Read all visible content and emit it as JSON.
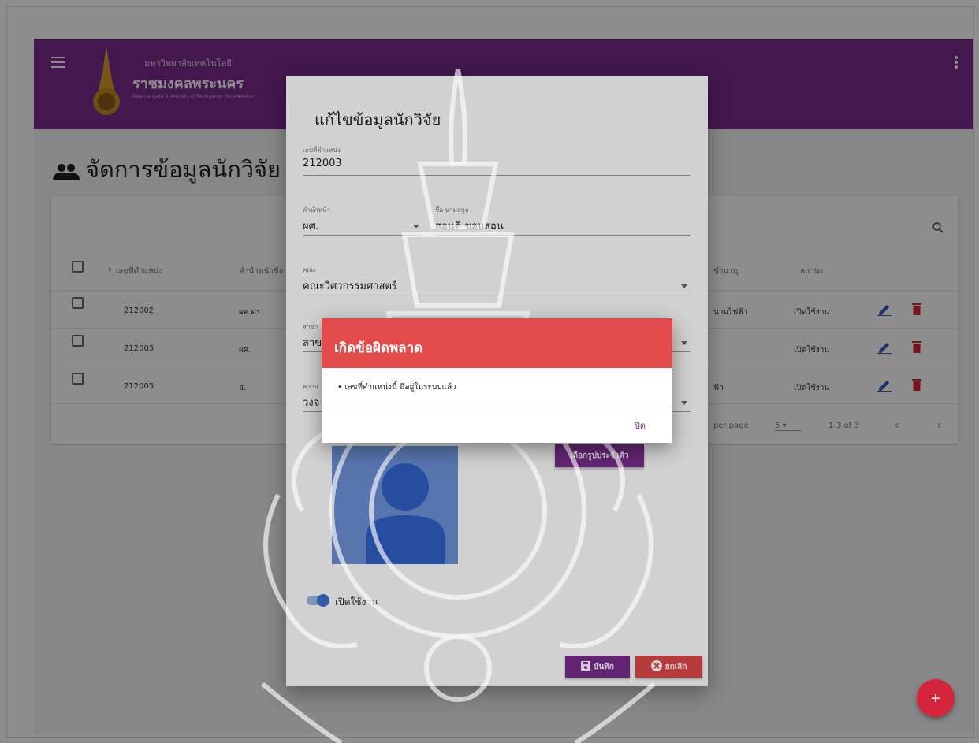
{
  "header": {
    "university_small": "มหาวิทยาลัยเทคโนโลยี",
    "university_big": "ราชมงคลพระนคร",
    "university_en": "Rajamangala University of Technology Phra Nakhon"
  },
  "page": {
    "title": "จัดการข้อมูลนักวิจัย"
  },
  "table": {
    "columns": {
      "position_no": "เลขที่ตำแหน่ง",
      "prefix_name": "คำนำหน้าชื่อ",
      "expertise": "ชำนาญ",
      "status": "สถานะ"
    },
    "rows": [
      {
        "position_no": "212002",
        "prefix": "ผศ.ดร.",
        "expertise": "นามไฟฟ้า",
        "status": "เปิดใช้งาน"
      },
      {
        "position_no": "212003",
        "prefix": "ผศ.",
        "expertise": "",
        "status": "เปิดใช้งาน"
      },
      {
        "position_no": "212003",
        "prefix": "อ.",
        "expertise": "ฟ้า",
        "status": "เปิดใช้งาน"
      }
    ],
    "footer": {
      "rows_per_page_label": "per page:",
      "rows_per_page": "5",
      "range": "1-3 of 3"
    }
  },
  "edit_dialog": {
    "title": "แก้ไขข้อมูลนักวิจัย",
    "position_no": {
      "label": "เลขที่ตำแหน่ง",
      "value": "212003"
    },
    "prefix": {
      "label": "คำนำหน้า",
      "value": "ผศ."
    },
    "fullname": {
      "label": "ชื่อ นามสกุล",
      "value": "สอนดี ชอบสอน"
    },
    "faculty": {
      "label": "คณะ",
      "value": "คณะวิศวกรรมศาสตร์"
    },
    "major": {
      "label": "สาขา",
      "value": "สาข"
    },
    "expertise": {
      "label": "ความ",
      "value": "วงจ"
    },
    "choose_photo_label": "เลือกรูปประจำตัว",
    "active_label": "เปิดใช้งาน",
    "save_label": "บันทึก",
    "cancel_label": "ยกเลิก"
  },
  "error_dialog": {
    "title": "เกิดข้อผิดพลาด",
    "message": "เลขที่ตำแหน่งนี้ มีอยู่ในระบบแล้ว",
    "close_label": "ปิด"
  },
  "fab": {
    "label": "+"
  },
  "colors": {
    "primary": "#7b2d8e",
    "danger": "#e24b4b",
    "edit": "#2f5fc4",
    "delete": "#d5263c"
  }
}
